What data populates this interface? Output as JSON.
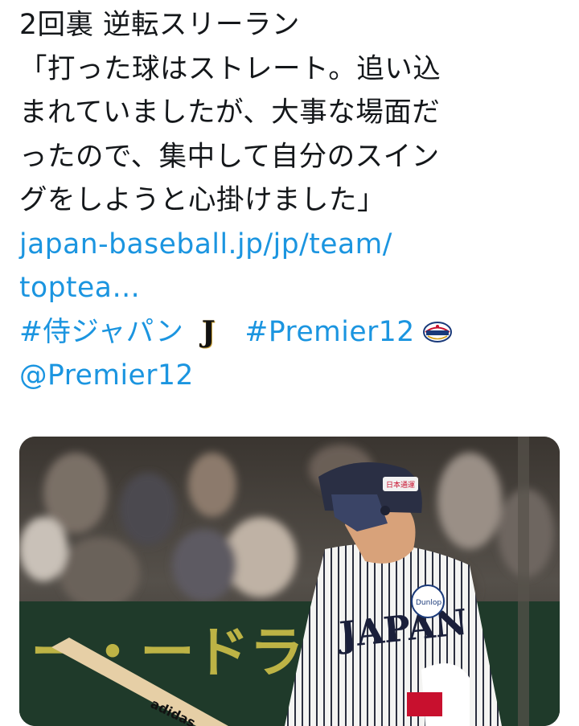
{
  "tweet": {
    "lines": [
      "2回裏 逆転スリーラン",
      "「打った球はストレート。追い込",
      "まれていましたが、大事な場面だ",
      "ったので、集中して自分のスイン",
      "グをしようと心掛けました」"
    ],
    "link_lines": [
      "japan-baseball.jp/jp/team/",
      "toptea…"
    ],
    "hashtags": [
      "#侍ジャパン",
      "#Premier12"
    ],
    "j_emoji": "J",
    "mention": "@Premier12"
  },
  "media": {
    "description_icon": "baseball-photo",
    "signboard_text": "ー・ードライ",
    "jersey_text": "JAPAN",
    "helmet_badge_text": "日本通運",
    "patch_text": "Dunlop",
    "bat_brand_text": "adidas"
  },
  "colors": {
    "text": "#14171a",
    "link": "#1b95e0",
    "background": "#ffffff"
  }
}
